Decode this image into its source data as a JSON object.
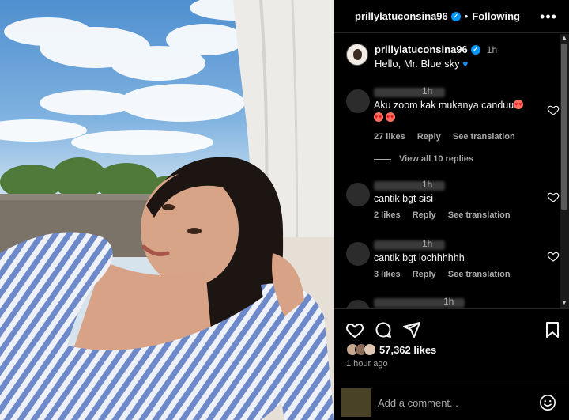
{
  "post": {
    "username": "prillylatuconsina96",
    "verified": true,
    "follow_state": "Following",
    "separator": "•",
    "more_icon": "more-horizontal-icon",
    "caption": {
      "username": "prillylatuconsina96",
      "time": "1h",
      "text": "Hello, Mr. Blue sky",
      "emoji": "blue-heart"
    }
  },
  "comments": [
    {
      "time": "1h",
      "text": "Aku zoom kak mukanya canduu",
      "likes": "27 likes",
      "reply": "Reply",
      "translate": "See translation"
    },
    {
      "time": "1h",
      "text": "cantik bgt sisi",
      "likes": "2 likes",
      "reply": "Reply",
      "translate": "See translation"
    },
    {
      "time": "1h",
      "text": "cantik bgt lochhhhhh",
      "likes": "3 likes",
      "reply": "Reply",
      "translate": "See translation"
    },
    {
      "time": "1h"
    }
  ],
  "view_replies": "View all 10 replies",
  "stats": {
    "likes": "57,362 likes",
    "posted": "1 hour ago"
  },
  "add_comment": {
    "placeholder": "Add a comment..."
  },
  "colors": {
    "background": "#000000",
    "verified": "#0095f6",
    "muted_text": "#a8a8a8",
    "border": "#262626"
  }
}
